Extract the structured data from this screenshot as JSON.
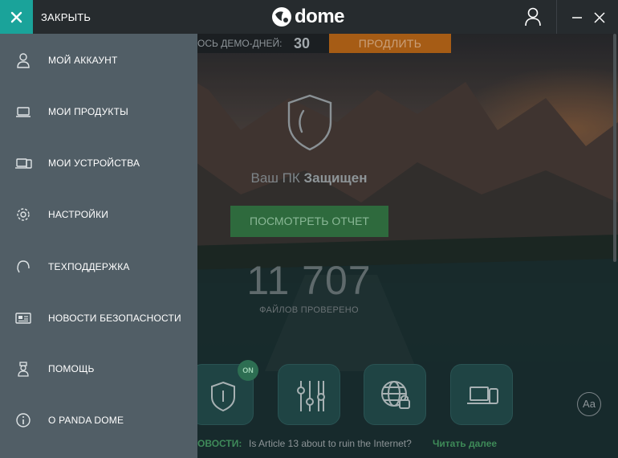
{
  "titlebar": {
    "close_label": "ЗАКРЫТЬ",
    "brand": "dome",
    "accent": "#1aa39a"
  },
  "demo": {
    "label": "ОСЬ ДЕМО-ДНЕЙ:",
    "days": "30",
    "extend_label": "ПРОДЛИТЬ"
  },
  "status": {
    "prefix": "Ваш ПК",
    "state": "Защищен",
    "report_button": "ПОСМОТРЕТЬ ОТЧЕТ",
    "files_count": "11 707",
    "files_label": "ФАЙЛОВ ПРОВЕРЕНО"
  },
  "tiles": {
    "on_badge": "ON",
    "items": [
      "shield-icon",
      "sliders-icon",
      "globe-lock-icon",
      "devices-icon"
    ]
  },
  "font_button": "Aa",
  "news": {
    "label": "ОВОСТИ:",
    "headline": "Is Article 13 about to ruin the Internet?",
    "link": "Читать далее"
  },
  "menu": {
    "items": [
      {
        "label": "МОЙ АККАУНТ",
        "icon": "user-icon"
      },
      {
        "label": "МОИ ПРОДУКТЫ",
        "icon": "laptop-icon"
      },
      {
        "label": "МОИ УСТРОЙСТВА",
        "icon": "devices-icon"
      },
      {
        "label": "НАСТРОЙКИ",
        "icon": "gear-icon"
      },
      {
        "label": "ТЕХПОДДЕРЖКА",
        "icon": "headset-icon"
      },
      {
        "label": "НОВОСТИ БЕЗОПАСНОСТИ",
        "icon": "newspaper-icon"
      },
      {
        "label": "ПОМОЩЬ",
        "icon": "help-person-icon"
      },
      {
        "label": "О PANDA DOME",
        "icon": "info-icon"
      }
    ]
  }
}
